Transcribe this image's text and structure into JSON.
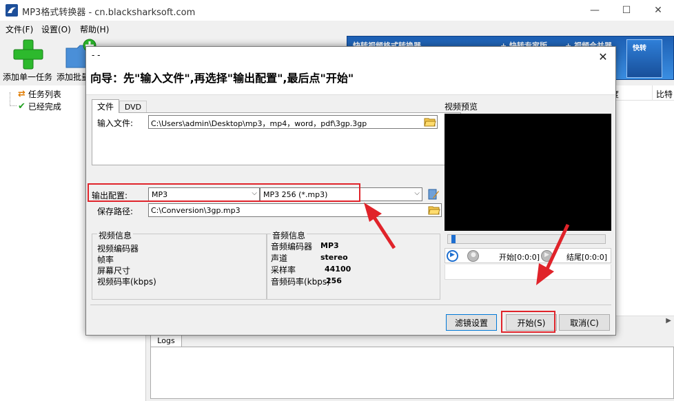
{
  "window": {
    "title": "MP3格式转换器 - cn.blacksharksoft.com",
    "controls": {
      "minimize": "—",
      "maximize": "☐",
      "close": "✕"
    }
  },
  "menu": {
    "items": [
      "文件(F)",
      "设置(O)",
      "帮助(H)"
    ]
  },
  "toolbar": {
    "add_single": "添加单一任务",
    "add_batch": "添加批量",
    "banner_items": [
      "快转视频格式转换器",
      "+ 快转专家版",
      "+ 视频合并器",
      "快转"
    ]
  },
  "tree": {
    "items": [
      "任务列表",
      "已经完成"
    ]
  },
  "list": {
    "columns": [
      "度",
      "比特"
    ]
  },
  "logs": {
    "tab_label": "Logs"
  },
  "dialog": {
    "title": "- -",
    "guide": "向导：先\"输入文件\",再选择\"输出配置\",最后点\"开始\"",
    "tabs": [
      "文件",
      "DVD"
    ],
    "input_label": "输入文件:",
    "input_value": "C:\\Users\\admin\\Desktop\\mp3，mp4，word，pdf\\3gp.3gp",
    "output_config_label": "输出配置:",
    "output_format": "MP3",
    "output_preset": "MP3 256 (*.mp3)",
    "save_path_label": "保存路径:",
    "save_path_value": "C:\\Conversion\\3gp.mp3",
    "video_info": {
      "title": "视频信息",
      "lines": [
        "视频编码器",
        "帧率",
        "屏幕尺寸",
        "视频码率(kbps)"
      ]
    },
    "audio_info": {
      "title": "音频信息",
      "labels": [
        "音频编码器",
        "声道",
        "采样率",
        "音频码率(kbps)"
      ],
      "values": [
        "MP3",
        "stereo",
        "44100",
        "256"
      ]
    },
    "preview": {
      "label": "视频预览",
      "start": "开始[0:0:0]",
      "end": "结尾[0:0:0]"
    },
    "buttons": {
      "filter": "滤镜设置",
      "start": "开始(S)",
      "cancel": "取消(C)"
    }
  },
  "colors": {
    "annotation": "#e0232a",
    "accent": "#0078d7",
    "banner": "#1d5fb3"
  }
}
